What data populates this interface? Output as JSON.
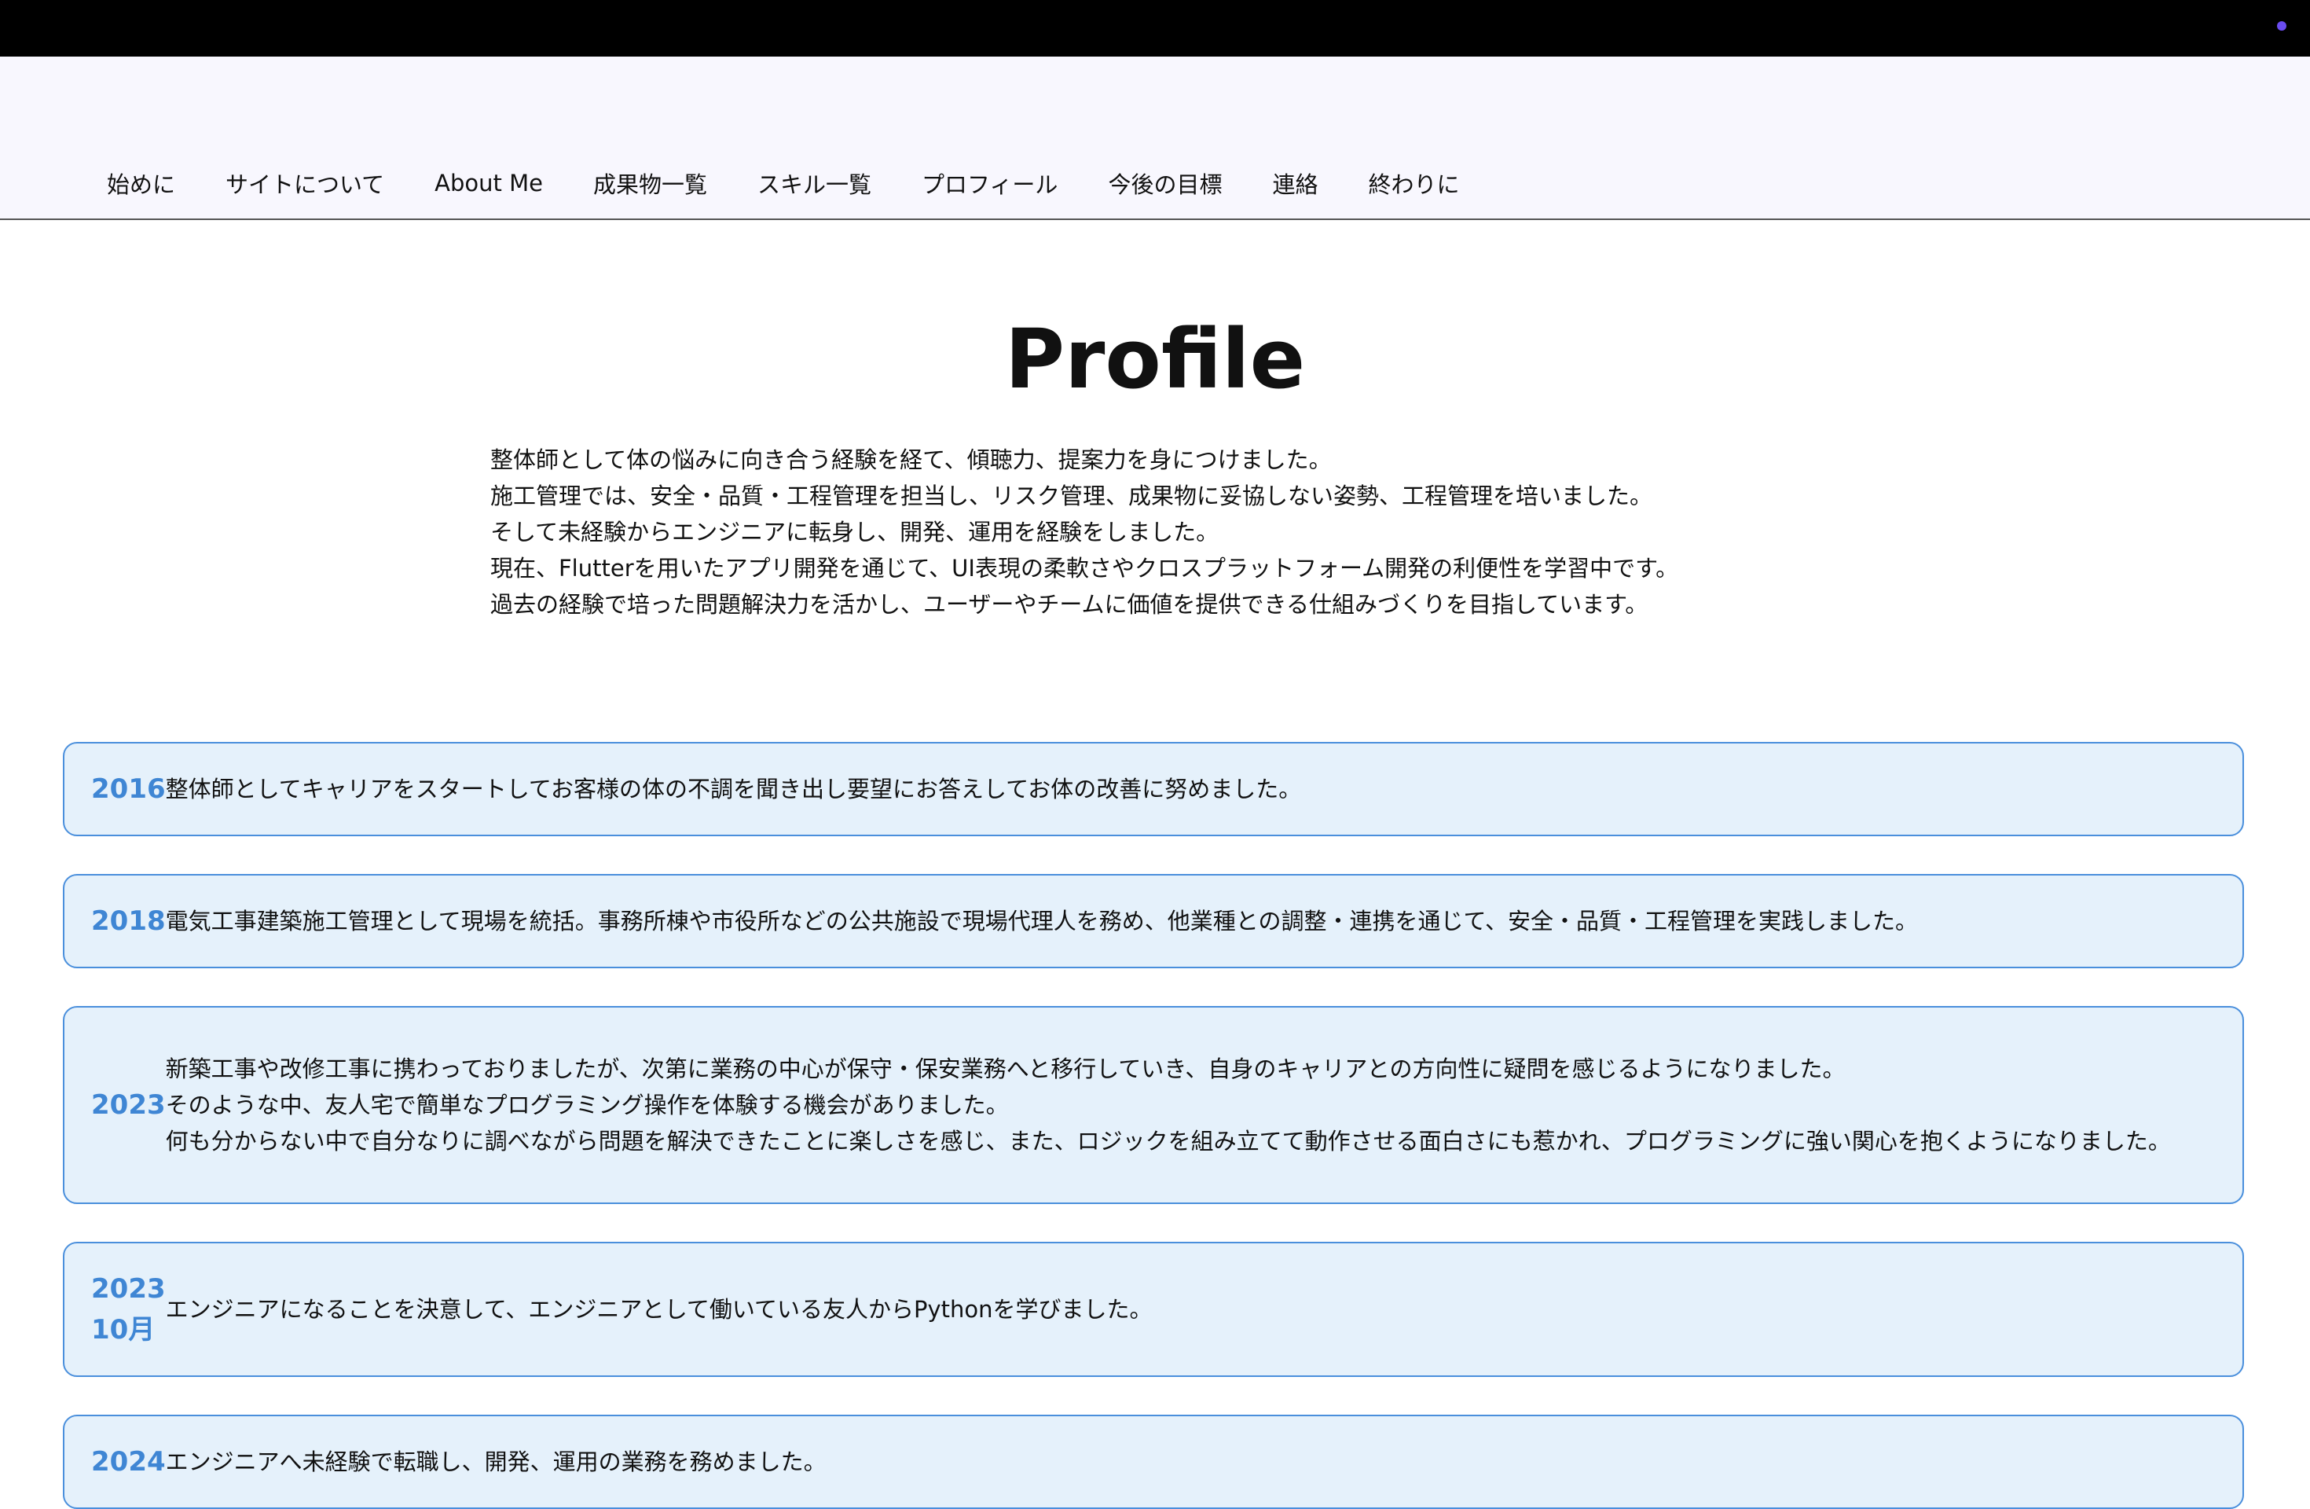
{
  "nav": {
    "items": [
      {
        "label": "始めに"
      },
      {
        "label": "サイトについて"
      },
      {
        "label": "About Me"
      },
      {
        "label": "成果物一覧"
      },
      {
        "label": "スキル一覧"
      },
      {
        "label": "プロフィール"
      },
      {
        "label": "今後の目標"
      },
      {
        "label": "連絡"
      },
      {
        "label": "終わりに"
      }
    ]
  },
  "profile": {
    "title": "Profile",
    "intro_lines": [
      "整体師として体の悩みに向き合う経験を経て、傾聴力、提案力を身につけました。",
      "施工管理では、安全・品質・工程管理を担当し、リスク管理、成果物に妥協しない姿勢、工程管理を培いました。",
      "そして未経験からエンジニアに転身し、開発、運用を経験をしました。",
      "現在、Flutterを用いたアプリ開発を通じて、UI表現の柔軟さやクロスプラットフォーム開発の利便性を学習中です。",
      "過去の経験で培った問題解決力を活かし、ユーザーやチームに価値を提供できる仕組みづくりを目指しています。"
    ]
  },
  "timeline": [
    {
      "year": "2016",
      "lines": [
        "整体師としてキャリアをスタートしてお客様の体の不調を聞き出し要望にお答えしてお体の改善に努めました。"
      ]
    },
    {
      "year": "2018",
      "lines": [
        "電気工事建築施工管理として現場を統括。事務所棟や市役所などの公共施設で現場代理人を務め、他業種との調整・連携を通じて、安全・品質・工程管理を実践しました。"
      ]
    },
    {
      "year": "2023",
      "lines": [
        "新築工事や改修工事に携わっておりましたが、次第に業務の中心が保守・保安業務へと移行していき、自身のキャリアとの方向性に疑問を感じるようになりました。",
        "そのような中、友人宅で簡単なプログラミング操作を体験する機会がありました。",
        "何も分からない中で自分なりに調べながら問題を解決できたことに楽しさを感じ、また、ロジックを組み立てて動作させる面白さにも惹かれ、プログラミングに強い関心を抱くようになりました。"
      ]
    },
    {
      "year": "2023",
      "month": "10月",
      "lines": [
        "エンジニアになることを決意して、エンジニアとして働いている友人からPythonを学びました。"
      ]
    },
    {
      "year": "2024",
      "lines": [
        "エンジニアへ未経験で転職し、開発、運用の業務を務めました。"
      ]
    }
  ],
  "colors": {
    "accent": "#3f86d4",
    "card_bg": "#e5f1fb",
    "card_border": "#4a8fdc",
    "header_bg": "#f8f7fe",
    "top_bar": "#000000",
    "indicator": "#6a4cf0"
  }
}
